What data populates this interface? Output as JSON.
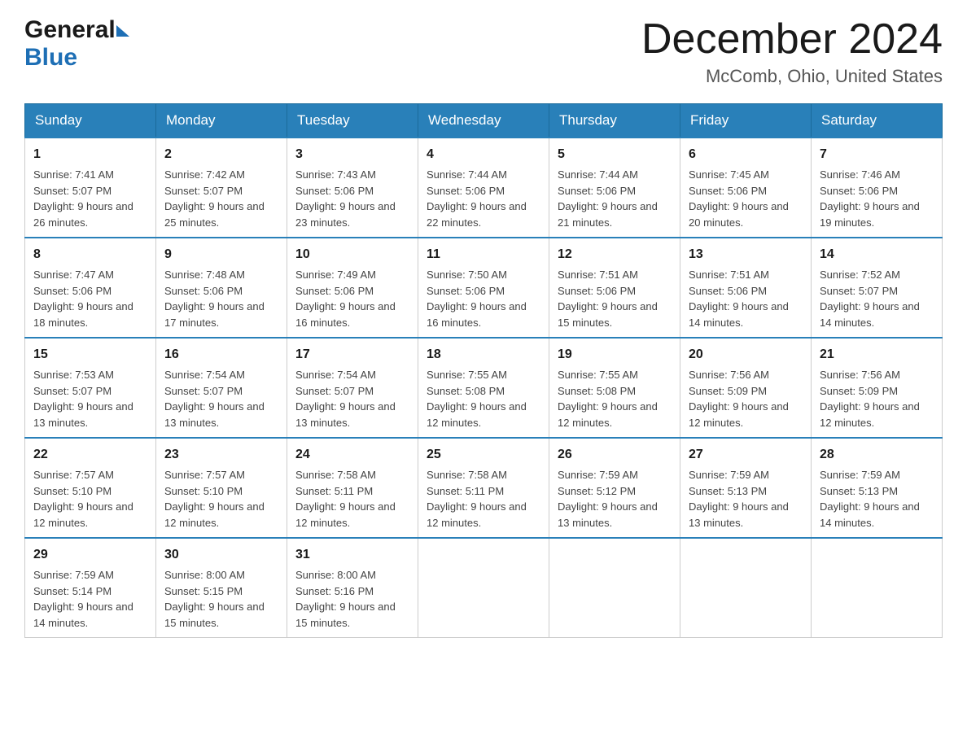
{
  "logo": {
    "general": "General",
    "blue": "Blue"
  },
  "title": {
    "month": "December 2024",
    "location": "McComb, Ohio, United States"
  },
  "weekdays": [
    "Sunday",
    "Monday",
    "Tuesday",
    "Wednesday",
    "Thursday",
    "Friday",
    "Saturday"
  ],
  "weeks": [
    [
      {
        "day": "1",
        "sunrise": "7:41 AM",
        "sunset": "5:07 PM",
        "daylight": "9 hours and 26 minutes."
      },
      {
        "day": "2",
        "sunrise": "7:42 AM",
        "sunset": "5:07 PM",
        "daylight": "9 hours and 25 minutes."
      },
      {
        "day": "3",
        "sunrise": "7:43 AM",
        "sunset": "5:06 PM",
        "daylight": "9 hours and 23 minutes."
      },
      {
        "day": "4",
        "sunrise": "7:44 AM",
        "sunset": "5:06 PM",
        "daylight": "9 hours and 22 minutes."
      },
      {
        "day": "5",
        "sunrise": "7:44 AM",
        "sunset": "5:06 PM",
        "daylight": "9 hours and 21 minutes."
      },
      {
        "day": "6",
        "sunrise": "7:45 AM",
        "sunset": "5:06 PM",
        "daylight": "9 hours and 20 minutes."
      },
      {
        "day": "7",
        "sunrise": "7:46 AM",
        "sunset": "5:06 PM",
        "daylight": "9 hours and 19 minutes."
      }
    ],
    [
      {
        "day": "8",
        "sunrise": "7:47 AM",
        "sunset": "5:06 PM",
        "daylight": "9 hours and 18 minutes."
      },
      {
        "day": "9",
        "sunrise": "7:48 AM",
        "sunset": "5:06 PM",
        "daylight": "9 hours and 17 minutes."
      },
      {
        "day": "10",
        "sunrise": "7:49 AM",
        "sunset": "5:06 PM",
        "daylight": "9 hours and 16 minutes."
      },
      {
        "day": "11",
        "sunrise": "7:50 AM",
        "sunset": "5:06 PM",
        "daylight": "9 hours and 16 minutes."
      },
      {
        "day": "12",
        "sunrise": "7:51 AM",
        "sunset": "5:06 PM",
        "daylight": "9 hours and 15 minutes."
      },
      {
        "day": "13",
        "sunrise": "7:51 AM",
        "sunset": "5:06 PM",
        "daylight": "9 hours and 14 minutes."
      },
      {
        "day": "14",
        "sunrise": "7:52 AM",
        "sunset": "5:07 PM",
        "daylight": "9 hours and 14 minutes."
      }
    ],
    [
      {
        "day": "15",
        "sunrise": "7:53 AM",
        "sunset": "5:07 PM",
        "daylight": "9 hours and 13 minutes."
      },
      {
        "day": "16",
        "sunrise": "7:54 AM",
        "sunset": "5:07 PM",
        "daylight": "9 hours and 13 minutes."
      },
      {
        "day": "17",
        "sunrise": "7:54 AM",
        "sunset": "5:07 PM",
        "daylight": "9 hours and 13 minutes."
      },
      {
        "day": "18",
        "sunrise": "7:55 AM",
        "sunset": "5:08 PM",
        "daylight": "9 hours and 12 minutes."
      },
      {
        "day": "19",
        "sunrise": "7:55 AM",
        "sunset": "5:08 PM",
        "daylight": "9 hours and 12 minutes."
      },
      {
        "day": "20",
        "sunrise": "7:56 AM",
        "sunset": "5:09 PM",
        "daylight": "9 hours and 12 minutes."
      },
      {
        "day": "21",
        "sunrise": "7:56 AM",
        "sunset": "5:09 PM",
        "daylight": "9 hours and 12 minutes."
      }
    ],
    [
      {
        "day": "22",
        "sunrise": "7:57 AM",
        "sunset": "5:10 PM",
        "daylight": "9 hours and 12 minutes."
      },
      {
        "day": "23",
        "sunrise": "7:57 AM",
        "sunset": "5:10 PM",
        "daylight": "9 hours and 12 minutes."
      },
      {
        "day": "24",
        "sunrise": "7:58 AM",
        "sunset": "5:11 PM",
        "daylight": "9 hours and 12 minutes."
      },
      {
        "day": "25",
        "sunrise": "7:58 AM",
        "sunset": "5:11 PM",
        "daylight": "9 hours and 12 minutes."
      },
      {
        "day": "26",
        "sunrise": "7:59 AM",
        "sunset": "5:12 PM",
        "daylight": "9 hours and 13 minutes."
      },
      {
        "day": "27",
        "sunrise": "7:59 AM",
        "sunset": "5:13 PM",
        "daylight": "9 hours and 13 minutes."
      },
      {
        "day": "28",
        "sunrise": "7:59 AM",
        "sunset": "5:13 PM",
        "daylight": "9 hours and 14 minutes."
      }
    ],
    [
      {
        "day": "29",
        "sunrise": "7:59 AM",
        "sunset": "5:14 PM",
        "daylight": "9 hours and 14 minutes."
      },
      {
        "day": "30",
        "sunrise": "8:00 AM",
        "sunset": "5:15 PM",
        "daylight": "9 hours and 15 minutes."
      },
      {
        "day": "31",
        "sunrise": "8:00 AM",
        "sunset": "5:16 PM",
        "daylight": "9 hours and 15 minutes."
      },
      null,
      null,
      null,
      null
    ]
  ],
  "labels": {
    "sunrise": "Sunrise: ",
    "sunset": "Sunset: ",
    "daylight": "Daylight: "
  }
}
